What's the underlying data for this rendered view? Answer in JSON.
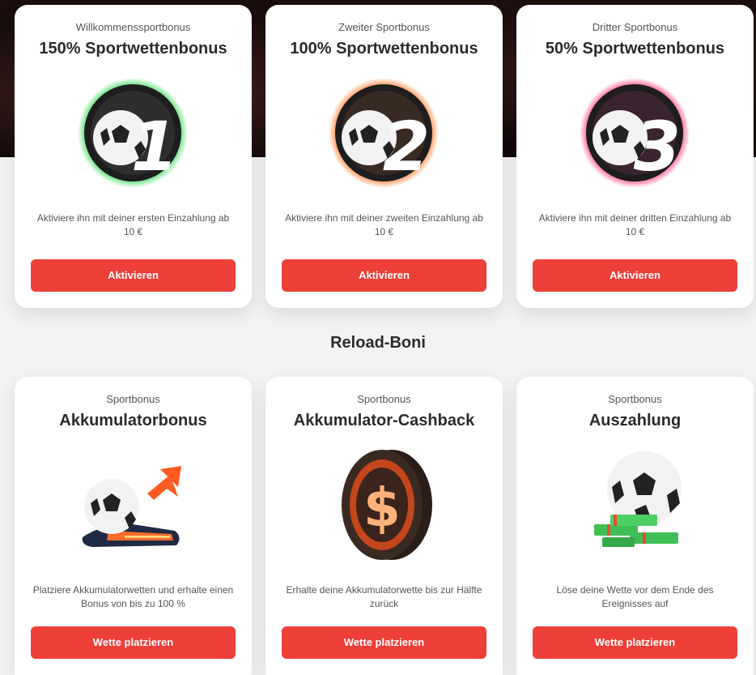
{
  "welcome_bonuses": [
    {
      "subtitle": "Willkommenssportbonus",
      "title": "150% Sportwettenbonus",
      "number": "1",
      "glow": "#2bd64a",
      "icon": "football-number-1-icon",
      "description": "Aktiviere ihn mit deiner ersten Einzahlung ab 10 €",
      "button": "Aktivieren"
    },
    {
      "subtitle": "Zweiter Sportbonus",
      "title": "100% Sportwettenbonus",
      "number": "2",
      "glow": "#ff7a2a",
      "icon": "football-number-2-icon",
      "description": "Aktiviere ihn mit deiner zweiten Einzahlung ab 10 €",
      "button": "Aktivieren"
    },
    {
      "subtitle": "Dritter Sportbonus",
      "title": "50% Sportwettenbonus",
      "number": "3",
      "glow": "#ff3d7f",
      "icon": "football-number-3-icon",
      "description": "Aktiviere ihn mit deiner dritten Einzahlung ab 10 €",
      "button": "Aktivieren"
    }
  ],
  "reload_section": {
    "title": "Reload-Boni"
  },
  "reload_bonuses": [
    {
      "subtitle": "Sportbonus",
      "title": "Akkumulatorbonus",
      "icon": "football-train-arrow-icon",
      "description": "Platziere Akkumulatorwetten und erhalte einen Bonus von bis zu 100 %",
      "button": "Wette platzieren"
    },
    {
      "subtitle": "Sportbonus",
      "title": "Akkumulator-Cashback",
      "icon": "dollar-coin-icon",
      "description": "Erhalte deine Akkumulatorwette bis zur Hälfte zurück",
      "button": "Wette platzieren"
    },
    {
      "subtitle": "Sportbonus",
      "title": "Auszahlung",
      "icon": "football-cash-stack-icon",
      "description": "Löse deine Wette vor dem Ende des Ereignisses auf",
      "button": "Wette platzieren"
    }
  ],
  "colors": {
    "button": "#ee3f39",
    "card": "#ffffff",
    "page": "#f3f3f3"
  }
}
